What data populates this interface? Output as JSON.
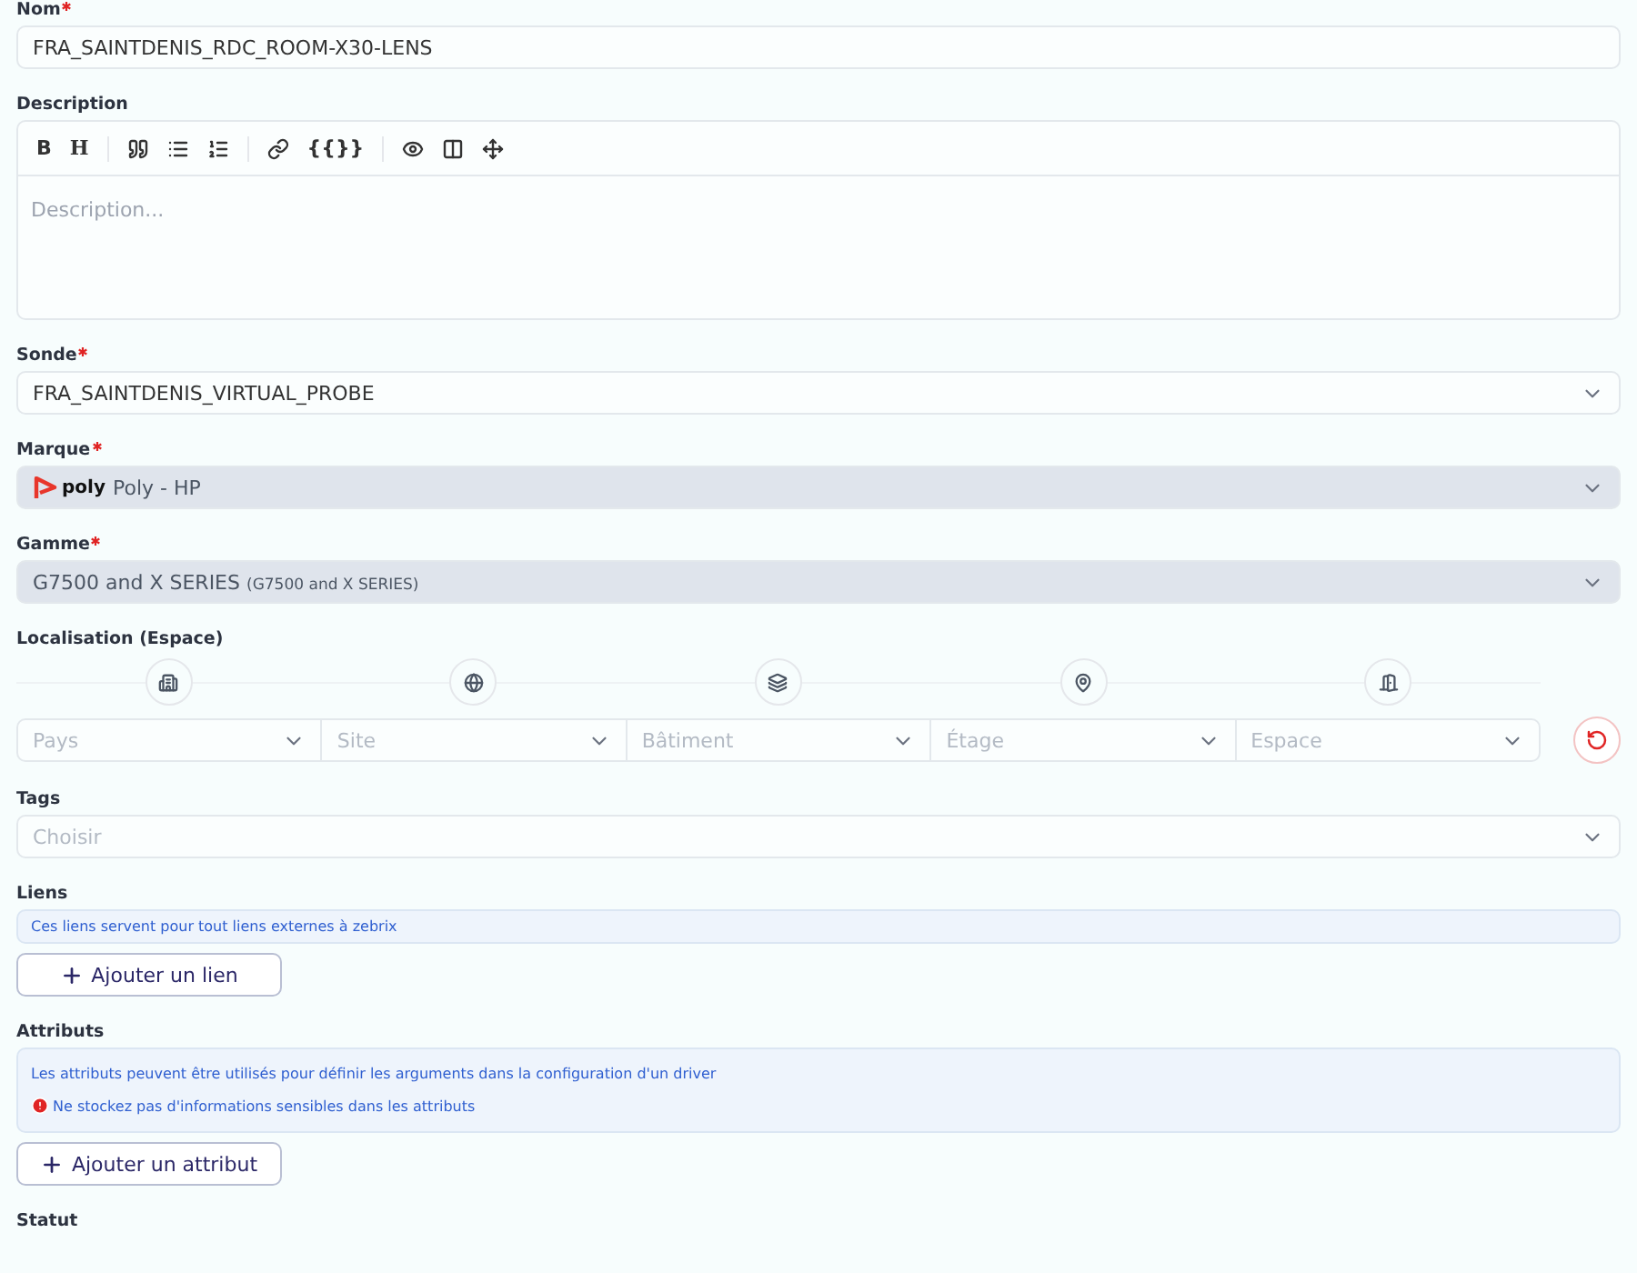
{
  "fields": [
    {
      "kind": "text",
      "label": "Nom",
      "required": true,
      "value": "FRA_SAINTDENIS_RDC_ROOM-X30-LENS"
    },
    {
      "kind": "editor",
      "label": "Description",
      "placeholder": "Description...",
      "toolbar": [
        {
          "kind": "text",
          "label": "B"
        },
        {
          "kind": "heading",
          "label": "H"
        },
        {
          "kind": "separator"
        },
        {
          "kind": "icon"
        },
        {
          "kind": "icon"
        },
        {
          "kind": "icon"
        },
        {
          "kind": "separator"
        },
        {
          "kind": "icon"
        },
        {
          "kind": "text",
          "label": "{{}}"
        },
        {
          "kind": "separator"
        },
        {
          "kind": "icon"
        },
        {
          "kind": "icon"
        },
        {
          "kind": "icon"
        }
      ]
    },
    {
      "kind": "select",
      "label": "Sonde",
      "required": true,
      "disabled": false,
      "value": "FRA_SAINTDENIS_VIRTUAL_PROBE"
    },
    {
      "kind": "select",
      "label": "Marque",
      "required": true,
      "disabled": true,
      "logo": "poly",
      "value": "Poly - HP"
    },
    {
      "kind": "select",
      "label": "Gamme",
      "required": true,
      "disabled": true,
      "value": "G7500 and X SERIES",
      "detail": "(G7500 and X SERIES)"
    },
    {
      "kind": "location",
      "label": "Localisation (Espace)",
      "steps": [
        {
          "placeholder": "Pays"
        },
        {
          "placeholder": "Site"
        },
        {
          "placeholder": "Bâtiment"
        },
        {
          "placeholder": "Étage"
        },
        {
          "placeholder": "Espace"
        }
      ]
    },
    {
      "kind": "select",
      "label": "Tags",
      "disabled": false,
      "placeholder": "Choisir"
    },
    {
      "kind": "list",
      "label": "Liens",
      "notes": [
        {
          "kind": "info",
          "text": "Ces liens servent pour tout liens externes à zebrix"
        }
      ],
      "button": "Ajouter un lien"
    },
    {
      "kind": "list",
      "label": "Attributs",
      "notes": [
        {
          "kind": "info",
          "text": "Les attributs peuvent être utilisés pour définir les arguments dans la configuration d'un driver"
        },
        {
          "kind": "warning",
          "text": "Ne stockez pas d'informations sensibles dans les attributs"
        }
      ],
      "button": "Ajouter un attribut"
    },
    {
      "kind": "label",
      "label": "Statut"
    }
  ]
}
